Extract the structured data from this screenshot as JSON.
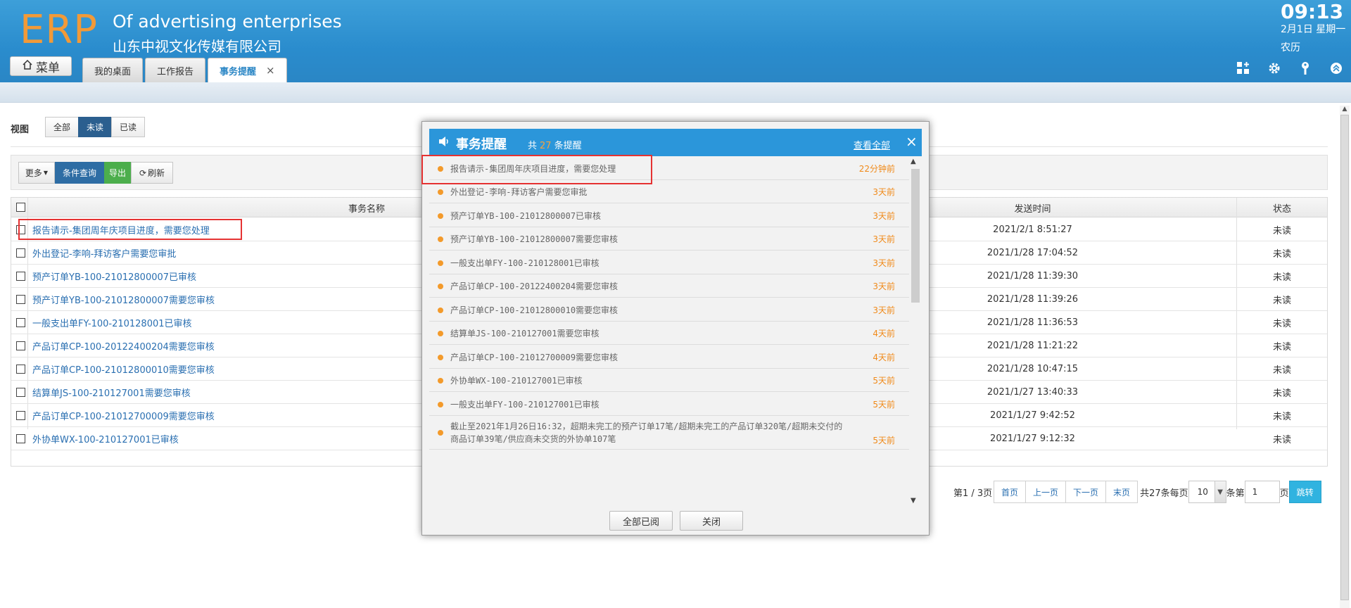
{
  "header": {
    "logo": "ERP",
    "company_en": "Of advertising enterprises",
    "company_cn": "山东中视文化传媒有限公司",
    "clock": "09:13",
    "date": "2月1日 星期一",
    "lunar": "农历",
    "menu_label": "菜单",
    "tabs": [
      {
        "label": "我的桌面"
      },
      {
        "label": "工作报告"
      },
      {
        "label": "事务提醒",
        "active": true
      }
    ],
    "tab_close": "×",
    "icons": [
      "grid-add-icon",
      "gear-icon",
      "key-icon",
      "collapse-icon"
    ]
  },
  "view": {
    "label": "视图",
    "options": [
      "全部",
      "未读",
      "已读"
    ],
    "selected": "未读"
  },
  "toolbar": {
    "more": "更多",
    "query": "条件查询",
    "export": "导出",
    "refresh": "刷新"
  },
  "grid": {
    "columns": [
      "事务名称",
      "发送时间",
      "状态"
    ],
    "rows": [
      {
        "name": "报告请示-集团周年庆项目进度，需要您处理",
        "time": "2021/2/1 8:51:27",
        "status": "未读"
      },
      {
        "name": "外出登记-李响-拜访客户需要您审批",
        "time": "2021/1/28 17:04:52",
        "status": "未读"
      },
      {
        "name": "预产订单YB-100-21012800007已审核",
        "time": "2021/1/28 11:39:30",
        "status": "未读"
      },
      {
        "name": "预产订单YB-100-21012800007需要您审核",
        "time": "2021/1/28 11:39:26",
        "status": "未读"
      },
      {
        "name": "一般支出单FY-100-210128001已审核",
        "time": "2021/1/28 11:36:53",
        "status": "未读"
      },
      {
        "name": "产品订单CP-100-20122400204需要您审核",
        "time": "2021/1/28 11:21:22",
        "status": "未读"
      },
      {
        "name": "产品订单CP-100-21012800010需要您审核",
        "time": "2021/1/28 10:47:15",
        "status": "未读"
      },
      {
        "name": "结算单JS-100-210127001需要您审核",
        "time": "2021/1/27 13:40:33",
        "status": "未读"
      },
      {
        "name": "产品订单CP-100-21012700009需要您审核",
        "time": "2021/1/27 9:42:52",
        "status": "未读"
      },
      {
        "name": "外协单WX-100-210127001已审核",
        "time": "2021/1/27 9:12:32",
        "status": "未读"
      }
    ]
  },
  "pager": {
    "page_info": "第1 / 3页",
    "first": "首页",
    "prev": "上一页",
    "next": "下一页",
    "last": "末页",
    "total": "共27条每页",
    "page_size": "10",
    "per_page_suffix": "条第",
    "page_input": "1",
    "page_suffix": "页",
    "jump": "跳转"
  },
  "popup": {
    "title": "事务提醒",
    "count_prefix": "共",
    "count": "27",
    "count_suffix": "条提醒",
    "view_all": "查看全部",
    "close": "×",
    "items": [
      {
        "text": "报告请示-集团周年庆项目进度，需要您处理",
        "time": "22分钟前"
      },
      {
        "text": "外出登记-李响-拜访客户需要您审批",
        "time": "3天前"
      },
      {
        "text": "预产订单YB-100-21012800007已审核",
        "time": "3天前"
      },
      {
        "text": "预产订单YB-100-21012800007需要您审核",
        "time": "3天前"
      },
      {
        "text": "一般支出单FY-100-210128001已审核",
        "time": "3天前"
      },
      {
        "text": "产品订单CP-100-20122400204需要您审核",
        "time": "3天前"
      },
      {
        "text": "产品订单CP-100-21012800010需要您审核",
        "time": "3天前"
      },
      {
        "text": "结算单JS-100-210127001需要您审核",
        "time": "4天前"
      },
      {
        "text": "产品订单CP-100-21012700009需要您审核",
        "time": "4天前"
      },
      {
        "text": "外协单WX-100-210127001已审核",
        "time": "5天前"
      },
      {
        "text": "一般支出单FY-100-210127001已审核",
        "time": "5天前"
      },
      {
        "text": "截止至2021年1月26日16:32，超期未完工的预产订单17笔/超期未完工的产品订单320笔/超期未交付的商品订单39笔/供应商未交货的外协单107笔",
        "time": "5天前"
      }
    ],
    "mark_all_read": "全部已阅",
    "close_button": "关闭"
  },
  "colors": {
    "header_blue": "#2a8ccd",
    "logo_orange": "#f29a38",
    "link_blue": "#2a6fb1",
    "highlight_red": "#e53232",
    "time_orange": "#f08a1a"
  }
}
